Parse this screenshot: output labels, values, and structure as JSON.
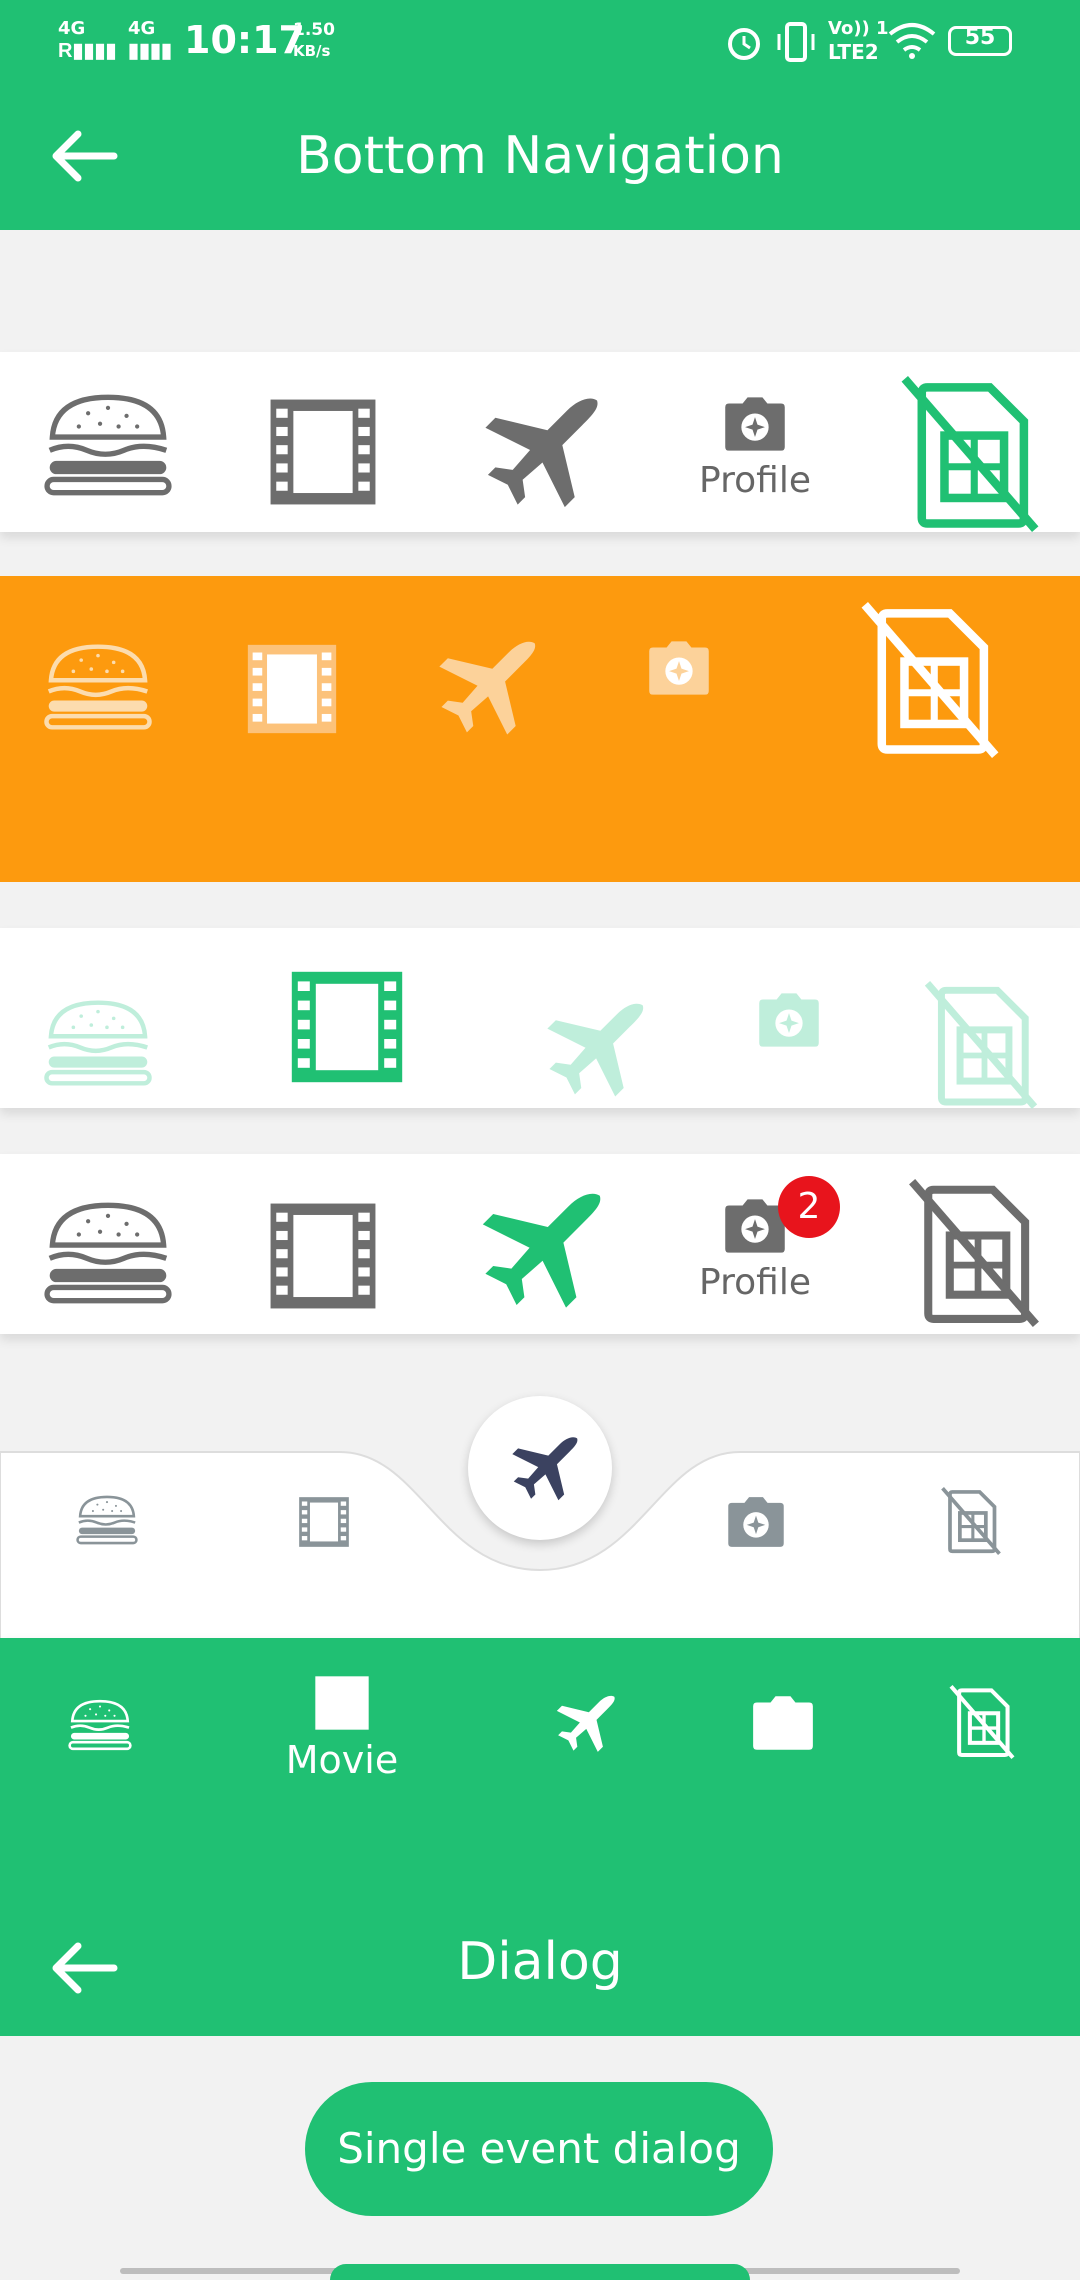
{
  "status_bar": {
    "network1": "4G",
    "network2": "4G",
    "time": "10:17",
    "speed_value": "1.50",
    "speed_unit": "KB/s",
    "volte": "Vo)) 1",
    "lte": "LTE2",
    "battery": "55"
  },
  "appbar": {
    "title": "Bottom Navigation"
  },
  "nav_bars": [
    {
      "style": "white",
      "items": [
        "burger-icon",
        "movie-icon",
        "airplane-icon",
        "camera-icon",
        "sim-off-icon"
      ],
      "selected_label": "Profile"
    },
    {
      "style": "orange",
      "items": [
        "burger-icon",
        "movie-icon",
        "airplane-icon",
        "camera-icon",
        "sim-off-icon"
      ]
    },
    {
      "style": "white-faded",
      "items": [
        "burger-icon",
        "movie-icon",
        "airplane-icon",
        "camera-icon",
        "sim-off-icon"
      ]
    },
    {
      "style": "white-badge",
      "items": [
        "burger-icon",
        "movie-icon",
        "airplane-icon",
        "camera-icon",
        "sim-off-icon"
      ],
      "label": "Profile",
      "badge": "2"
    },
    {
      "style": "curved",
      "items": [
        "burger-icon",
        "movie-icon",
        "airplane-icon",
        "camera-icon",
        "sim-off-icon"
      ]
    },
    {
      "style": "green",
      "items": [
        "burger-icon",
        "movie-icon",
        "airplane-icon",
        "camera-icon",
        "sim-off-icon"
      ],
      "label": "Movie"
    }
  ],
  "dialog_bar": {
    "title": "Dialog"
  },
  "dialog_button": {
    "label": "Single event dialog"
  },
  "colors": {
    "green": "#20c073",
    "orange": "#fd9a0e",
    "gray": "#6d6d6d",
    "navy": "#3b4260",
    "badge": "#e8141c"
  }
}
